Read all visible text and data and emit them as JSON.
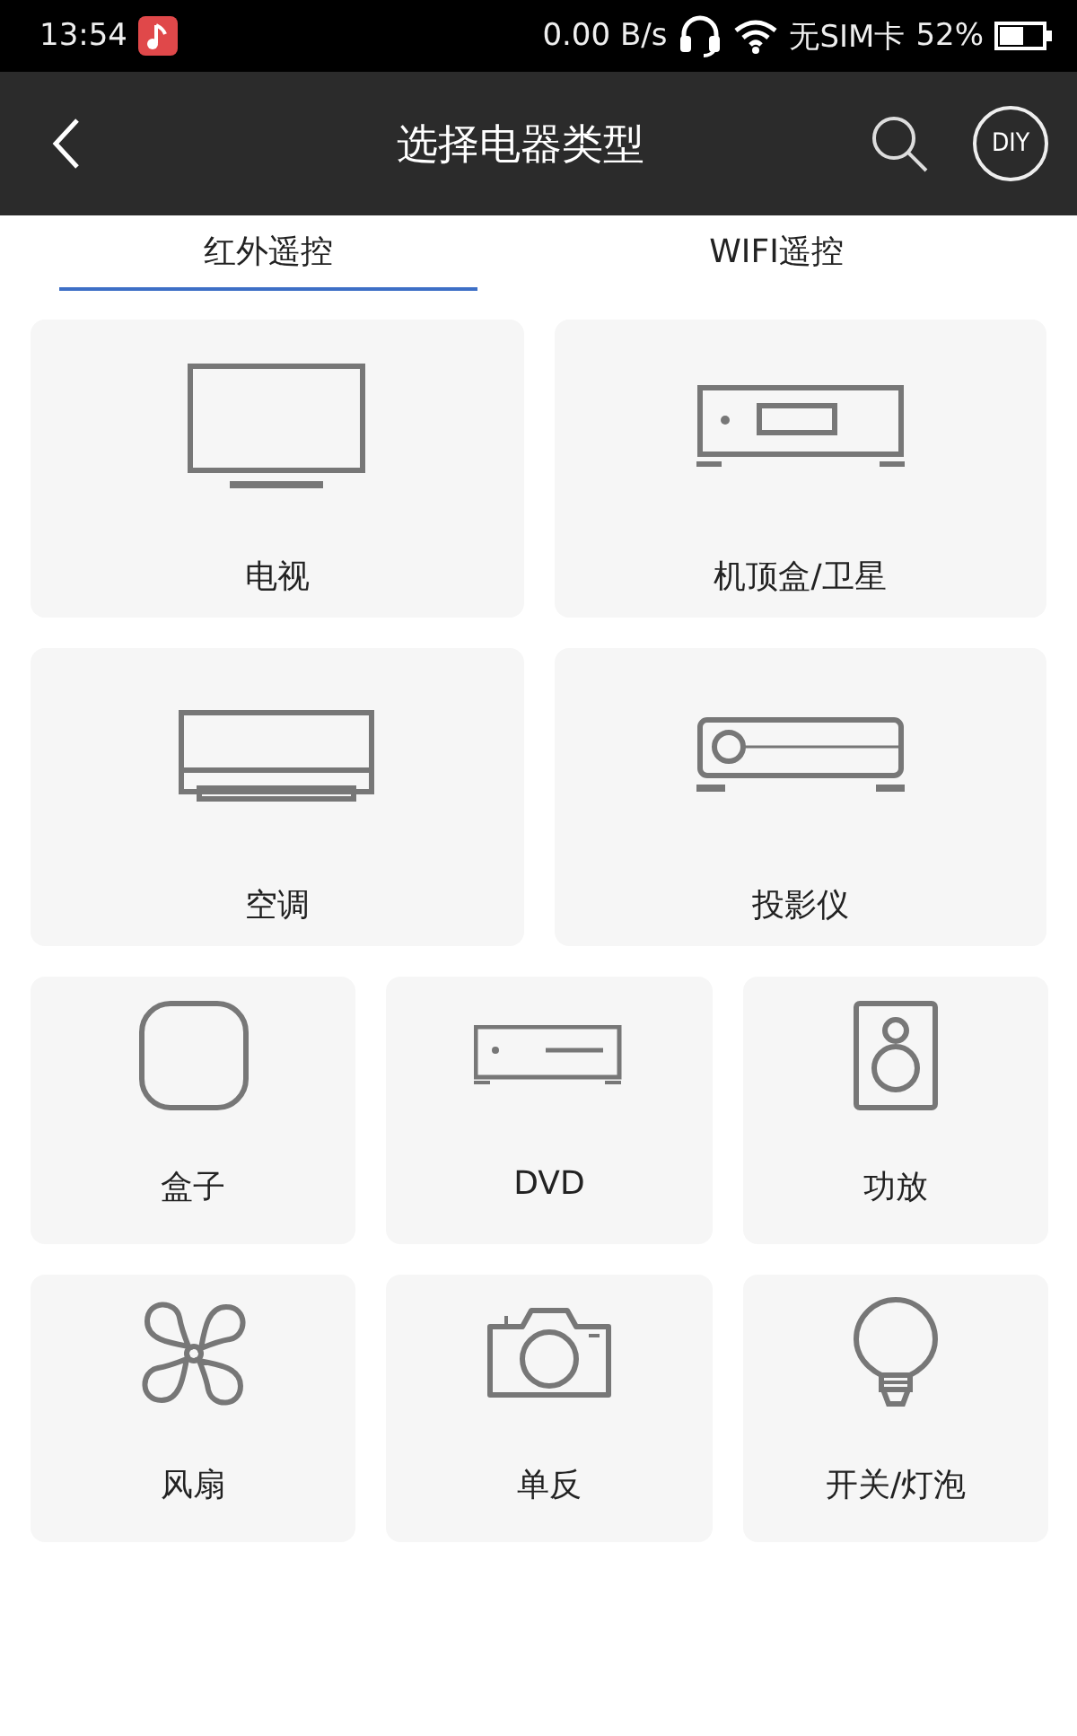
{
  "status_bar": {
    "time": "13:54",
    "speed": "0.00 B/s",
    "sim": "无SIM卡",
    "battery": "52%"
  },
  "app_bar": {
    "title": "选择电器类型",
    "diy": "DIY"
  },
  "tabs": [
    {
      "label": "红外遥控",
      "selected": true
    },
    {
      "label": "WIFI遥控",
      "selected": false
    }
  ],
  "large_devices": [
    {
      "kind": "tv",
      "label": "电视"
    },
    {
      "kind": "settop",
      "label": "机顶盒/卫星"
    },
    {
      "kind": "ac",
      "label": "空调"
    },
    {
      "kind": "projector",
      "label": "投影仪"
    }
  ],
  "small_devices": [
    {
      "kind": "box",
      "label": "盒子"
    },
    {
      "kind": "dvd",
      "label": "DVD"
    },
    {
      "kind": "speaker",
      "label": "功放"
    },
    {
      "kind": "fan",
      "label": "风扇"
    },
    {
      "kind": "camera",
      "label": "单反"
    },
    {
      "kind": "bulb",
      "label": "开关/灯泡"
    }
  ]
}
